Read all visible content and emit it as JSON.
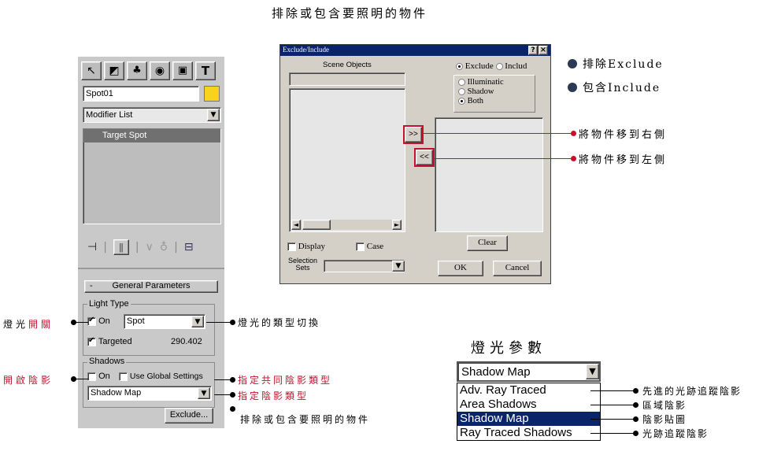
{
  "page_title": "排除或包含要照明的物件",
  "left_panel": {
    "object_name": "Spot01",
    "object_color": "#f7d21e",
    "modifier_list": "Modifier List",
    "stack_item": "Target Spot",
    "general_params": "General Parameters",
    "light_type_group": "Light Type",
    "on_label": "On",
    "light_type_value": "Spot",
    "targeted_label": "Targeted",
    "targeted_value": "290.402",
    "shadows_group": "Shadows",
    "shadows_on_label": "On",
    "use_global_label": "Use Global Settings",
    "shadow_type_value": "Shadow Map",
    "exclude_button": "Exclude...",
    "collapse_sign": "-"
  },
  "dialog": {
    "title": "Exclude/Include",
    "help_btn": "?",
    "close_btn": "×",
    "scene_objects_label": "Scene Objects",
    "exclude_label": "Exclude",
    "include_label": "Includ",
    "illuminate_label": "Illuminatic",
    "shadow_label": "Shadow",
    "both_label": "Both",
    "move_right": ">>",
    "move_left": "<<",
    "display_label": "Display",
    "case_label": "Case",
    "selection_sets_label1": "Selection",
    "selection_sets_label2": "Sets",
    "clear_btn": "Clear",
    "ok_btn": "OK",
    "cancel_btn": "Cancel"
  },
  "annotations": {
    "exclude": "排除Exclude",
    "include": "包含Include",
    "move_right": "將物件移到右側",
    "move_left": "將物件移到左側",
    "light_onoff_a": "燈光",
    "light_onoff_b": "開關",
    "light_type_switch": "燈光的類型切換",
    "shadow_on_a": "開啟陰影",
    "shared_shadow_type": "指定共同陰影類型",
    "shadow_type": "指定陰影類型",
    "exclude_desc": "排除或包含要照明的物件"
  },
  "shadow_panel": {
    "heading": "燈光參數",
    "selected": "Shadow Map",
    "options": [
      {
        "label": "Adv. Ray Traced",
        "desc": "先進的光跡追蹤陰影"
      },
      {
        "label": "Area Shadows",
        "desc": "區域陰影"
      },
      {
        "label": "Shadow Map",
        "desc": "陰影貼圖"
      },
      {
        "label": "Ray Traced Shadows",
        "desc": "光跡追蹤陰影"
      }
    ]
  }
}
